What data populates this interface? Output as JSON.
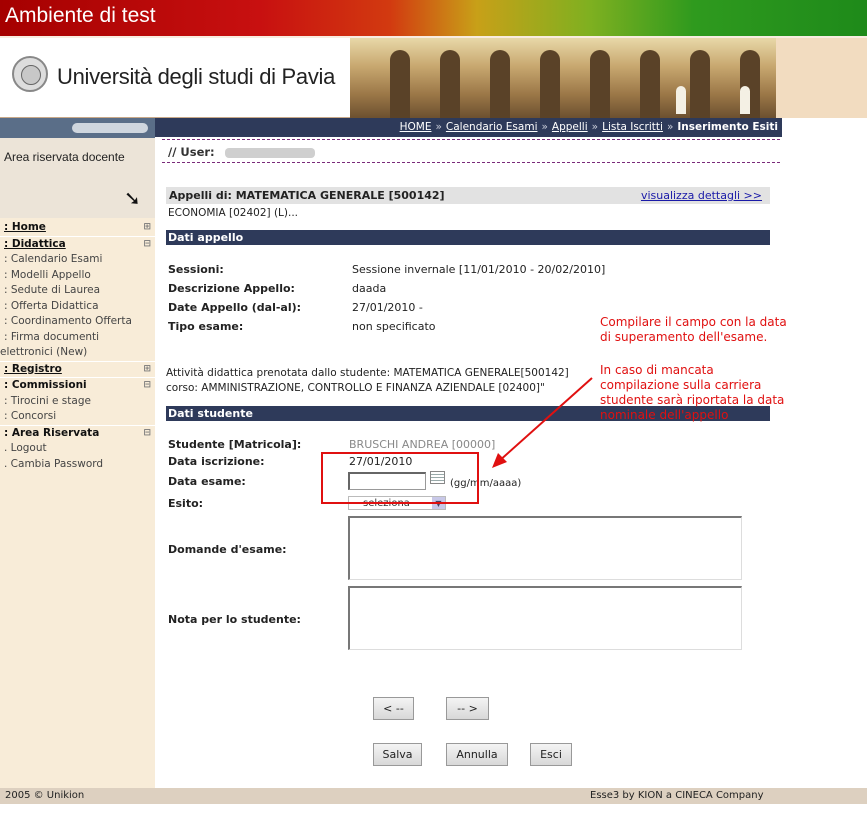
{
  "header": {
    "env_title": "Ambiente di test",
    "university": "Università degli studi di Pavia"
  },
  "sidebar": {
    "area_label": "Area riservata docente",
    "items": [
      {
        "label": ": Home",
        "kind": "head",
        "expand": "⊞"
      },
      {
        "label": ": Didattica",
        "kind": "head",
        "expand": "⊟"
      },
      {
        "label": ":  Calendario Esami",
        "kind": "sub"
      },
      {
        "label": ":  Modelli Appello",
        "kind": "sub"
      },
      {
        "label": ":  Sedute di Laurea",
        "kind": "sub"
      },
      {
        "label": ":  Offerta Didattica",
        "kind": "sub"
      },
      {
        "label": ":  Coordinamento Offerta",
        "kind": "sub"
      },
      {
        "label": ":  Firma documenti",
        "kind": "sub"
      },
      {
        "label": "elettronici (New)",
        "kind": "cont"
      },
      {
        "label": ": Registro",
        "kind": "head",
        "expand": "⊞"
      },
      {
        "label": ": Commissioni",
        "kind": "headnou",
        "expand": "⊟"
      },
      {
        "label": ":  Tirocini e stage",
        "kind": "sub"
      },
      {
        "label": ":  Concorsi",
        "kind": "sub"
      },
      {
        "label": ": Area Riservata",
        "kind": "headnou",
        "expand": "⊟"
      },
      {
        "label": ". Logout",
        "kind": "sub"
      },
      {
        "label": ". Cambia Password",
        "kind": "sub"
      }
    ]
  },
  "breadcrumb": {
    "items": [
      "HOME",
      "Calendario Esami",
      "Appelli",
      "Lista Iscritti"
    ],
    "current": "Inserimento Esiti",
    "separator": "»"
  },
  "user": {
    "label": "// User:"
  },
  "appelli": {
    "title": "Appelli di: MATEMATICA GENERALE [500142]",
    "details_link": "visualizza dettagli >>",
    "subtitle": "ECONOMIA [02402] (L)..."
  },
  "dati_appello": {
    "section_title": "Dati appello",
    "rows": [
      {
        "label": "Sessioni:",
        "value": "Sessione invernale [11/01/2010 - 20/02/2010]"
      },
      {
        "label": "Descrizione Appello:",
        "value": "daada"
      },
      {
        "label": "Date Appello (dal-al):",
        "value": "27/01/2010 -"
      },
      {
        "label": "Tipo esame:",
        "value": "non specificato"
      }
    ]
  },
  "attivita": {
    "line1": "Attività didattica prenotata dallo studente: MATEMATICA GENERALE[500142]",
    "line2": "corso: AMMINISTRAZIONE, CONTROLLO E FINANZA AZIENDALE [02400]\""
  },
  "dati_studente": {
    "section_title": "Dati studente",
    "student_label": "Studente [Matricola]:",
    "student_value": "BRUSCHI ANDREA [00000]",
    "iscrizione_label": "Data iscrizione:",
    "iscrizione_value": "27/01/2010",
    "data_esame_label": "Data esame:",
    "data_esame_value": "",
    "date_hint": "(gg/mm/aaaa)",
    "esito_label": "Esito:",
    "esito_value": "seleziona",
    "domande_label": "Domande d'esame:",
    "nota_label": "Nota per lo studente:"
  },
  "annotation": {
    "para1": [
      "Compilare il campo con la data",
      "di superamento dell'esame."
    ],
    "para2": [
      "In caso di mancata",
      "compilazione sulla carriera",
      "studente sarà riportata la data",
      "nominale dell'appello"
    ]
  },
  "buttons": {
    "prev": "< --",
    "next": "-- >",
    "save": "Salva",
    "cancel": "Annulla",
    "exit": "Esci"
  },
  "footer": {
    "left": "2005 © Unikion",
    "right": "Esse3 by KION a CINECA Company"
  },
  "colors": {
    "nav_bg": "#2e3a5a",
    "annotation_red": "#e01010",
    "sidebar_bg": "#f8ecd8"
  }
}
